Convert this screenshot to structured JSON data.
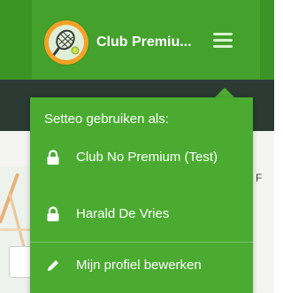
{
  "header": {
    "club_name": "Club Premiu...",
    "avatar_icon": "tennis-racket-icon",
    "menu_icon": "hamburger-icon"
  },
  "dropdown": {
    "title": "Setteo gebruiken als:",
    "items": [
      {
        "label": "Club No Premium (Test)",
        "icon": "lock-icon"
      },
      {
        "label": "Harald De Vries",
        "icon": "lock-icon"
      },
      {
        "label": "Mijn profiel bewerken",
        "icon": "pencil-icon"
      }
    ]
  },
  "background": {
    "edge_text": "F"
  },
  "colors": {
    "header_green": "#43a12c",
    "menu_green": "#4aab30",
    "dark_band": "#2b3a33",
    "avatar_ring": "#f6a125"
  }
}
